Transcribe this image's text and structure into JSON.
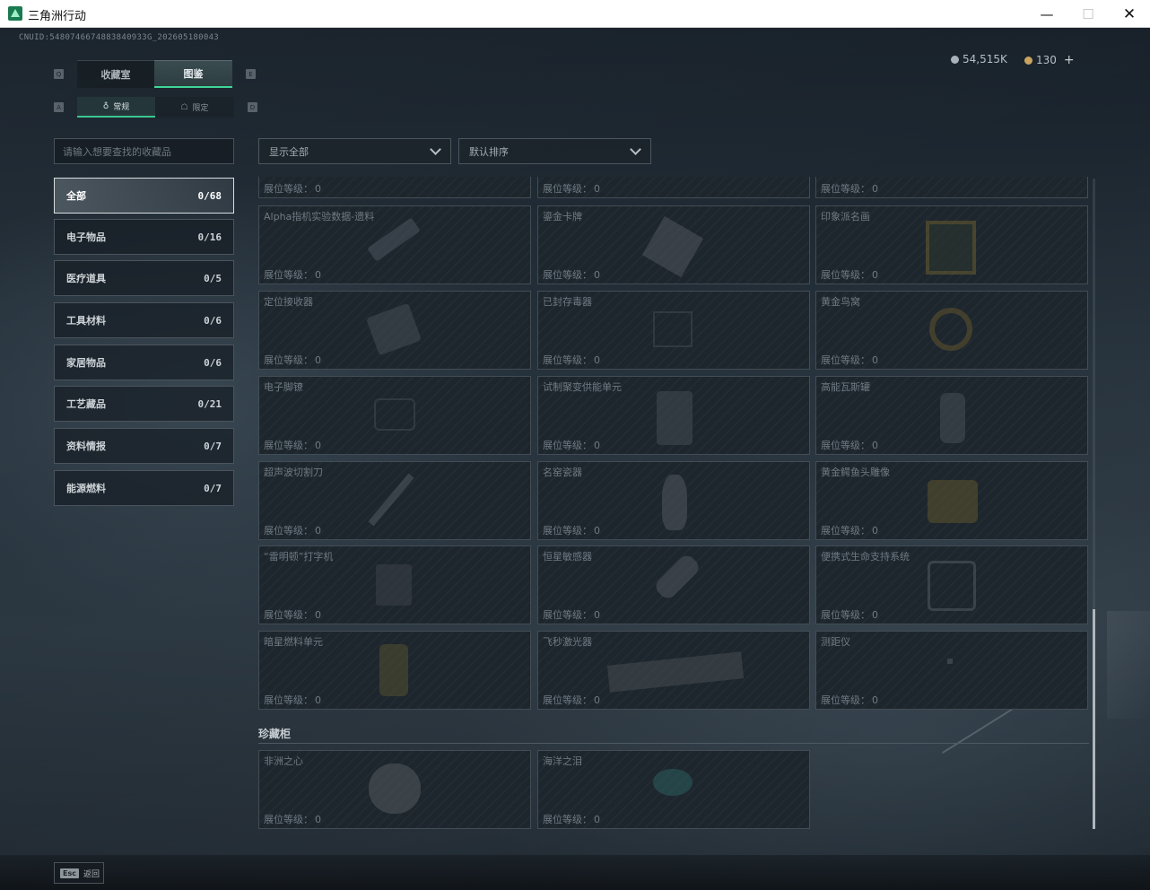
{
  "window": {
    "title": "三角洲行动",
    "min_glyph": "—",
    "max_glyph": "☐",
    "close_glyph": "✕"
  },
  "header": {
    "cnuid": "CNUID:5480746674883840933G_202605180043",
    "currency": [
      {
        "value": "54,515K"
      },
      {
        "value": "130",
        "add_label": "+"
      }
    ]
  },
  "tabs": {
    "key_left": "Q",
    "key_right": "E",
    "items": [
      {
        "label": "收藏室"
      },
      {
        "label": "图鉴",
        "active": true
      }
    ]
  },
  "subtabs": {
    "key_left": "A",
    "key_right": "D",
    "items": [
      {
        "label": "常规",
        "active": true
      },
      {
        "label": "限定"
      }
    ]
  },
  "search": {
    "placeholder": "请输入想要查找的收藏品"
  },
  "filters": {
    "show": "显示全部",
    "sort": "默认排序"
  },
  "categories": [
    {
      "label": "全部",
      "count": "0/68",
      "active": true
    },
    {
      "label": "电子物品",
      "count": "0/16"
    },
    {
      "label": "医疗道具",
      "count": "0/5"
    },
    {
      "label": "工具材料",
      "count": "0/6"
    },
    {
      "label": "家居物品",
      "count": "0/6"
    },
    {
      "label": "工艺藏品",
      "count": "0/21"
    },
    {
      "label": "资料情报",
      "count": "0/7"
    },
    {
      "label": "能源燃料",
      "count": "0/7"
    }
  ],
  "level_label": "展位等级：",
  "items": [
    {
      "name": "",
      "level": "0"
    },
    {
      "name": "",
      "level": "0"
    },
    {
      "name": "",
      "level": "0"
    },
    {
      "name": "Alpha指机实验数据-遗料",
      "level": "0"
    },
    {
      "name": "鎏金卡牌",
      "level": "0"
    },
    {
      "name": "印象派名画",
      "level": "0"
    },
    {
      "name": "定位接收器",
      "level": "0"
    },
    {
      "name": "已封存毒器",
      "level": "0"
    },
    {
      "name": "黄金鸟窝",
      "level": "0"
    },
    {
      "name": "电子脚镣",
      "level": "0"
    },
    {
      "name": "试制聚变供能单元",
      "level": "0"
    },
    {
      "name": "高能瓦斯罐",
      "level": "0"
    },
    {
      "name": "超声波切割刀",
      "level": "0"
    },
    {
      "name": "名窑瓷器",
      "level": "0"
    },
    {
      "name": "黄金鳄鱼头雕像",
      "level": "0"
    },
    {
      "name": "“雷明顿”打字机",
      "level": "0"
    },
    {
      "name": "恒星敏感器",
      "level": "0"
    },
    {
      "name": "便携式生命支持系统",
      "level": "0"
    },
    {
      "name": "暗星燃料单元",
      "level": "0"
    },
    {
      "name": "飞秒激光器",
      "level": "0"
    },
    {
      "name": "测距仪",
      "level": "0"
    }
  ],
  "cabinet": {
    "title": "珍藏柜",
    "items": [
      {
        "name": "非洲之心",
        "level": "0"
      },
      {
        "name": "海洋之泪",
        "level": "0"
      }
    ]
  },
  "footer": {
    "esc_key": "Esc",
    "back_label": "返回"
  },
  "colors": {
    "accent": "#3fd69a",
    "background": "#1b2229"
  }
}
